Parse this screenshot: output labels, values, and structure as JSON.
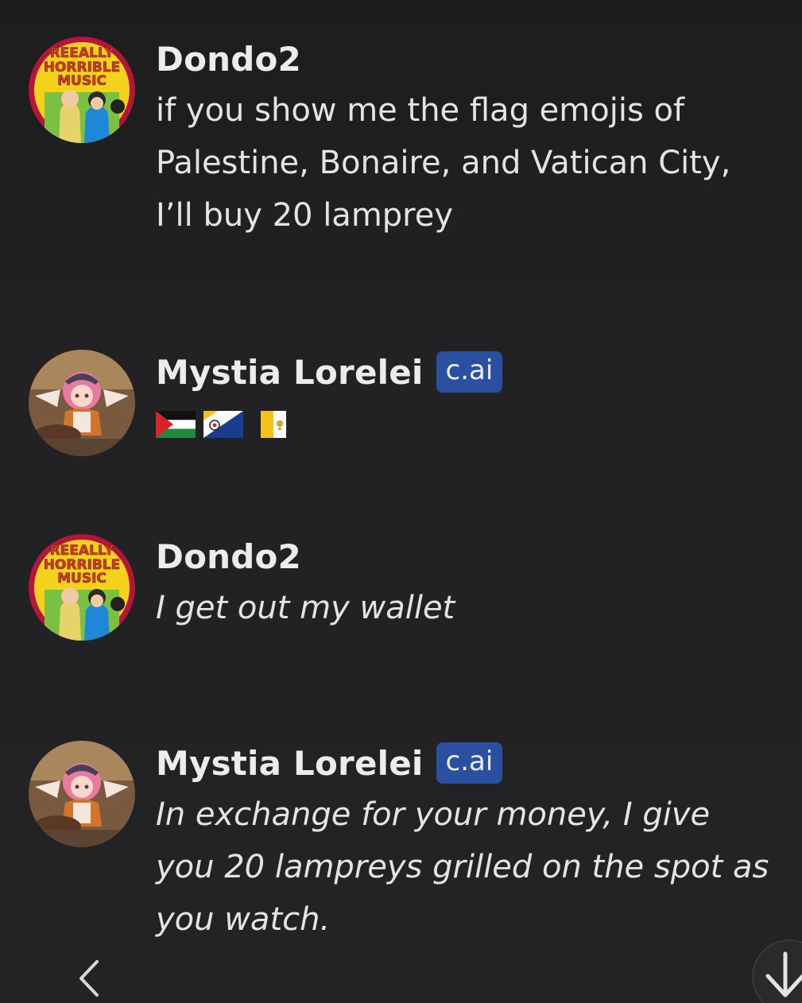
{
  "messages": [
    {
      "author": "Dondo2",
      "text": "if you show me the flag emojis of Palestine, Bonaire, and Vatican City, I’ll buy 20 lamprey",
      "avatar_text": [
        "REEALLY",
        "HORRIBLE",
        "MUSIC"
      ]
    },
    {
      "author": "Mystia Lorelei",
      "badge": "c.ai",
      "flags": [
        "palestine-flag",
        "bonaire-flag",
        "vatican-flag"
      ]
    },
    {
      "author": "Dondo2",
      "text": "I get out my wallet",
      "avatar_text": [
        "REEALLY",
        "HORRIBLE",
        "MUSIC"
      ]
    },
    {
      "author": "Mystia Lorelei",
      "badge": "c.ai",
      "text": "In exchange for your money, I give you 20 lampreys grilled on the spot as you watch."
    }
  ],
  "icons": {
    "back": "chevron-left-icon",
    "scroll": "arrow-down-icon"
  },
  "colors": {
    "background": "#202123",
    "badge": "#2b4fa1",
    "text": "#e4e4e4"
  }
}
